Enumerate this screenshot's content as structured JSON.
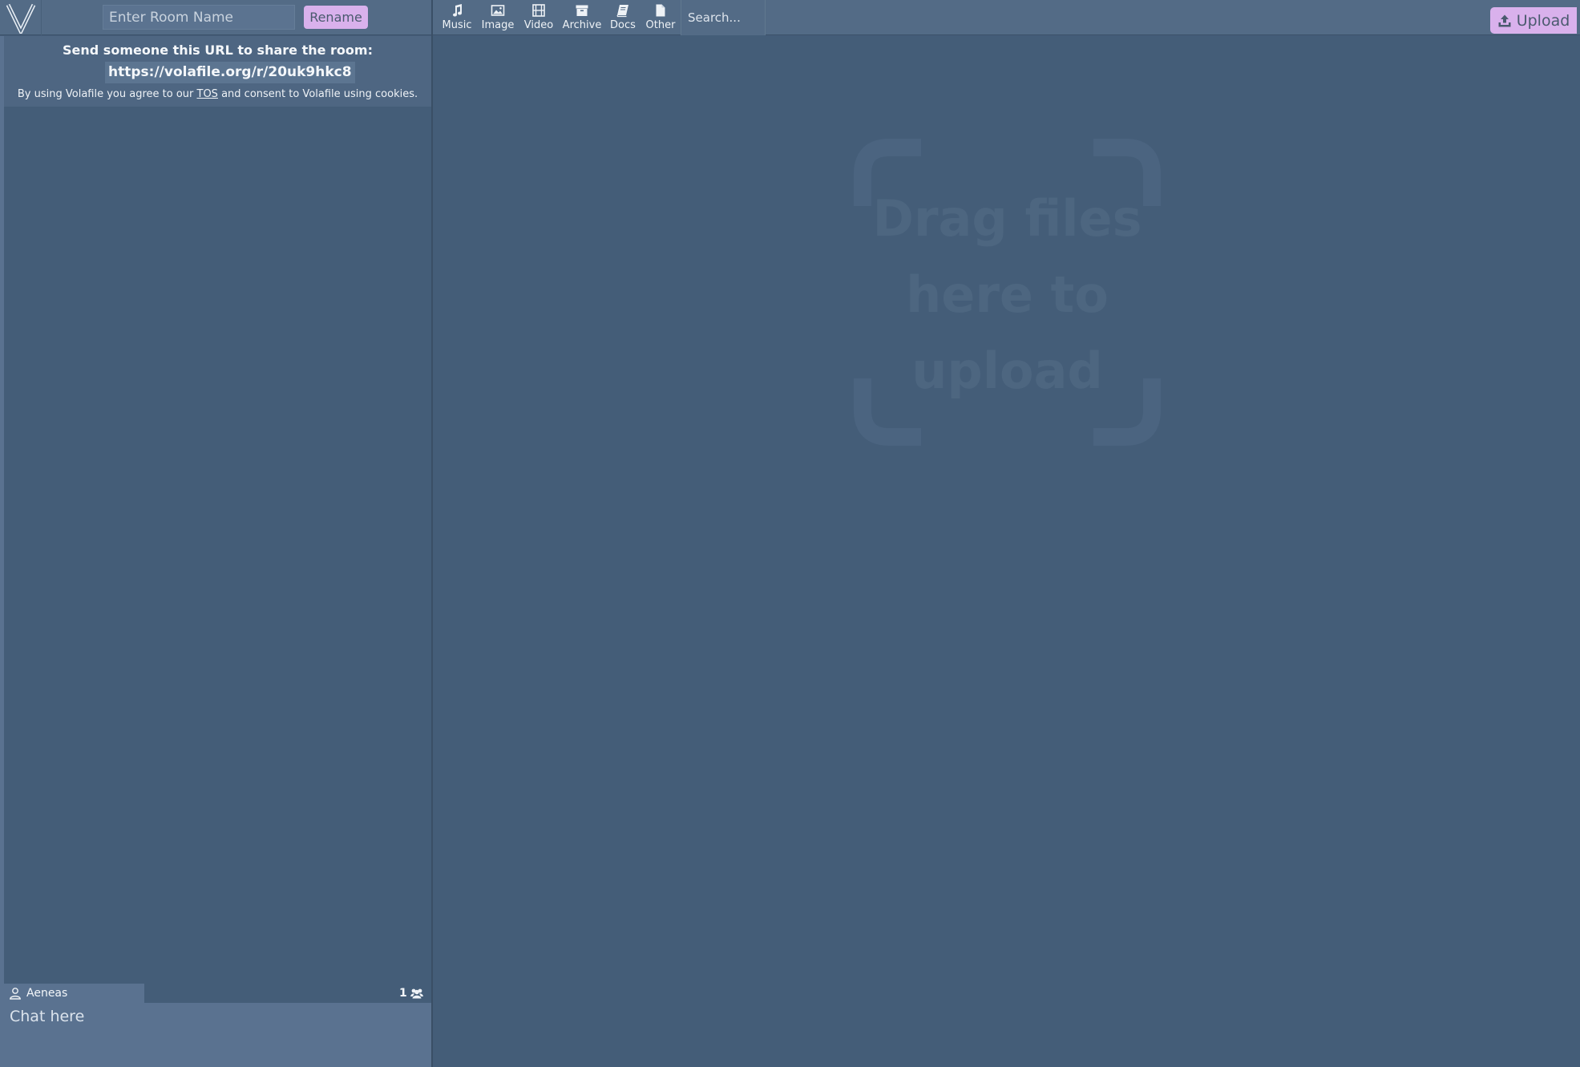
{
  "colors": {
    "background": "#445d78",
    "topbar": "#536b86",
    "accent": "#d9b1ec",
    "chat_input": "#5a7290"
  },
  "header": {
    "logo_icon": "volafile-v-logo",
    "room_name_placeholder": "Enter Room Name",
    "rename_label": "Rename",
    "filters": [
      {
        "label": "Music",
        "icon": "music-note-icon"
      },
      {
        "label": "Image",
        "icon": "image-icon"
      },
      {
        "label": "Video",
        "icon": "film-icon"
      },
      {
        "label": "Archive",
        "icon": "archive-box-icon"
      },
      {
        "label": "Docs",
        "icon": "book-icon"
      },
      {
        "label": "Other",
        "icon": "file-icon"
      }
    ],
    "search_placeholder": "Search...",
    "upload_label": "Upload",
    "upload_icon": "upload-icon"
  },
  "share": {
    "title": "Send someone this URL to share the room:",
    "url": "https://volafile.org/r/20uk9hkc8",
    "tos_prefix": "By using Volafile you agree to our",
    "tos_link": "TOS",
    "tos_suffix": "and consent to Volafile using cookies."
  },
  "chat": {
    "username": "Aeneas",
    "user_icon": "user-icon",
    "user_count": "1",
    "users_icon": "users-icon",
    "input_placeholder": "Chat here"
  },
  "drop_zone": {
    "lines": [
      "Drag files",
      "here to",
      "upload"
    ]
  }
}
